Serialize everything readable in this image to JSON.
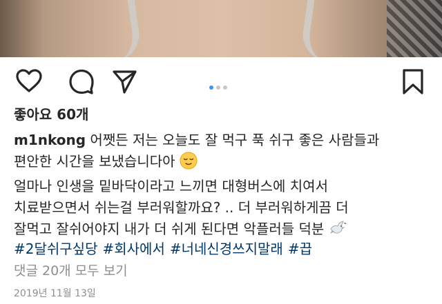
{
  "post": {
    "likes": "좋아요 60개",
    "username": "m1nkong",
    "caption_lines": [
      " 어쨋든 저는 오늘도 잘 먹구 푹 쉬구 좋은 사람들과",
      "편안한 시간을 보냈습니다아 ",
      "얼마나 인생을 밑바닥이라고 느끼면 대형버스에 치여서",
      "치료받으면서 쉬는걸 부러워할까요? .. 더 부러워하게끔 더",
      "잘먹고 잘쉬어야지 내가 더 쉬게 된다면 악플러들 덕분 "
    ],
    "hashtags": [
      "#2달쉬구싶당",
      "#회사에서",
      "#너네신경쓰지말래",
      "#끕"
    ],
    "comments_link": "댓글 20개 모두 보기",
    "date": "2019년 11월 13일"
  },
  "icons": [
    "heart-icon",
    "comment-icon",
    "share-icon",
    "bookmark-icon",
    "relieved-face-emoji",
    "dove-emoji"
  ],
  "colors": {
    "hashtag": "#00376b",
    "muted": "#8e8e8e",
    "active_dot": "#3897f0",
    "text": "#262626"
  }
}
